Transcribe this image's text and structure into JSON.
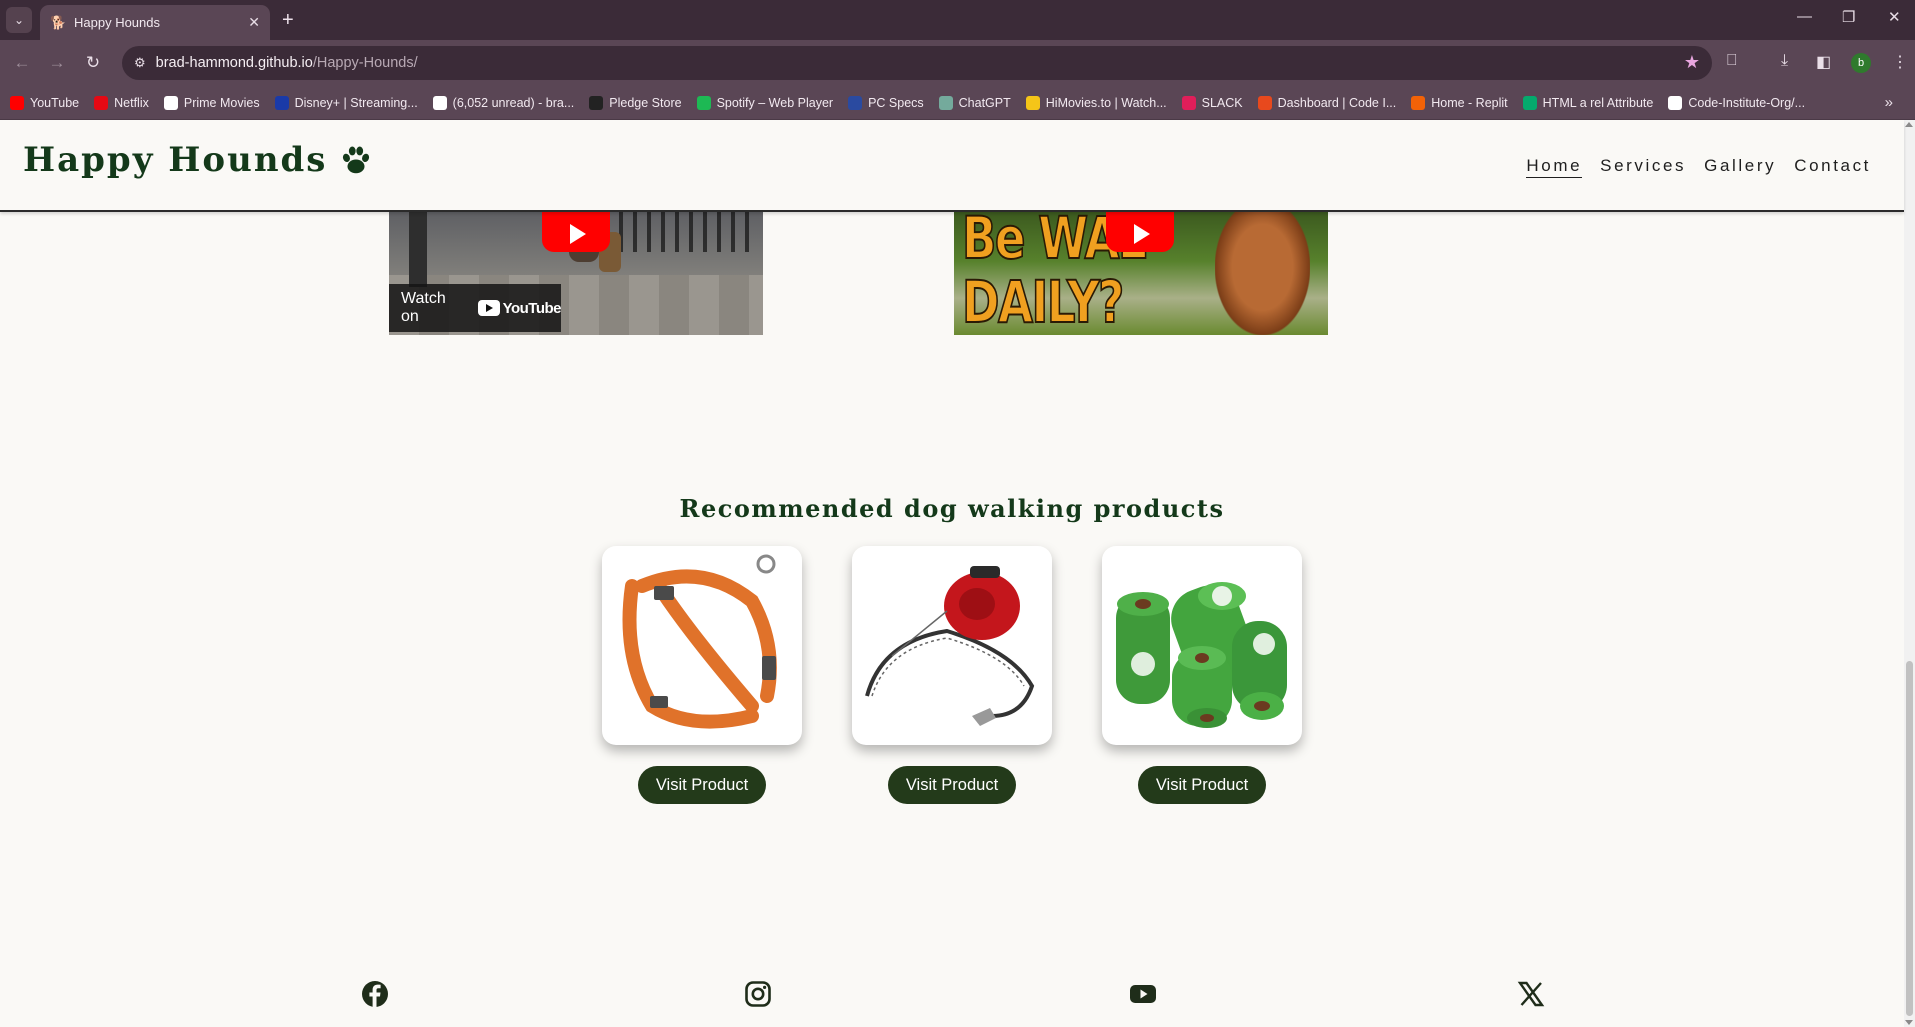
{
  "browser": {
    "tab_title": "Happy Hounds",
    "url_host": "brad-hammond.github.io",
    "url_path": "/Happy-Hounds/",
    "profile_initial": "b",
    "bookmarks": [
      {
        "label": "YouTube",
        "color": "#ff0000"
      },
      {
        "label": "Netflix",
        "color": "#e50914"
      },
      {
        "label": "Prime Movies",
        "color": "#ffffff"
      },
      {
        "label": "Disney+ | Streaming...",
        "color": "#1a3aa8"
      },
      {
        "label": "(6,052 unread) - bra...",
        "color": "#ffffff"
      },
      {
        "label": "Pledge Store",
        "color": "#222222"
      },
      {
        "label": "Spotify – Web Player",
        "color": "#1db954"
      },
      {
        "label": "PC Specs",
        "color": "#2a4aa0"
      },
      {
        "label": "ChatGPT",
        "color": "#74aa9c"
      },
      {
        "label": "HiMovies.to | Watch...",
        "color": "#f5c518"
      },
      {
        "label": "SLACK",
        "color": "#e01e5a"
      },
      {
        "label": "Dashboard | Code I...",
        "color": "#e8491d"
      },
      {
        "label": "Home - Replit",
        "color": "#f26207"
      },
      {
        "label": "HTML a rel Attribute",
        "color": "#04aa6d"
      },
      {
        "label": "Code-Institute-Org/...",
        "color": "#ffffff"
      }
    ]
  },
  "site": {
    "brand": "Happy Hounds",
    "nav": [
      {
        "label": "Home",
        "active": true
      },
      {
        "label": "Services",
        "active": false
      },
      {
        "label": "Gallery",
        "active": false
      },
      {
        "label": "Contact",
        "active": false
      }
    ],
    "video1": {
      "watch_on": "Watch on",
      "platform": "YouTube"
    },
    "video2": {
      "thumb_line1": "Be WAL",
      "thumb_line2": "DAILY?"
    },
    "products_title": "Recommended dog walking products",
    "products": [
      {
        "name": "orange dog harness",
        "button": "Visit Product"
      },
      {
        "name": "red retractable lead",
        "button": "Visit Product"
      },
      {
        "name": "green poop bags",
        "button": "Visit Product"
      }
    ],
    "social": [
      "facebook-icon",
      "instagram-icon",
      "youtube-icon",
      "x-icon"
    ]
  },
  "colors": {
    "brand_green": "#14391a",
    "button_bg": "#233a1a",
    "browser_frame": "#3b2b38",
    "browser_toolbar": "#5a4655",
    "page_bg": "#faf9f6"
  }
}
